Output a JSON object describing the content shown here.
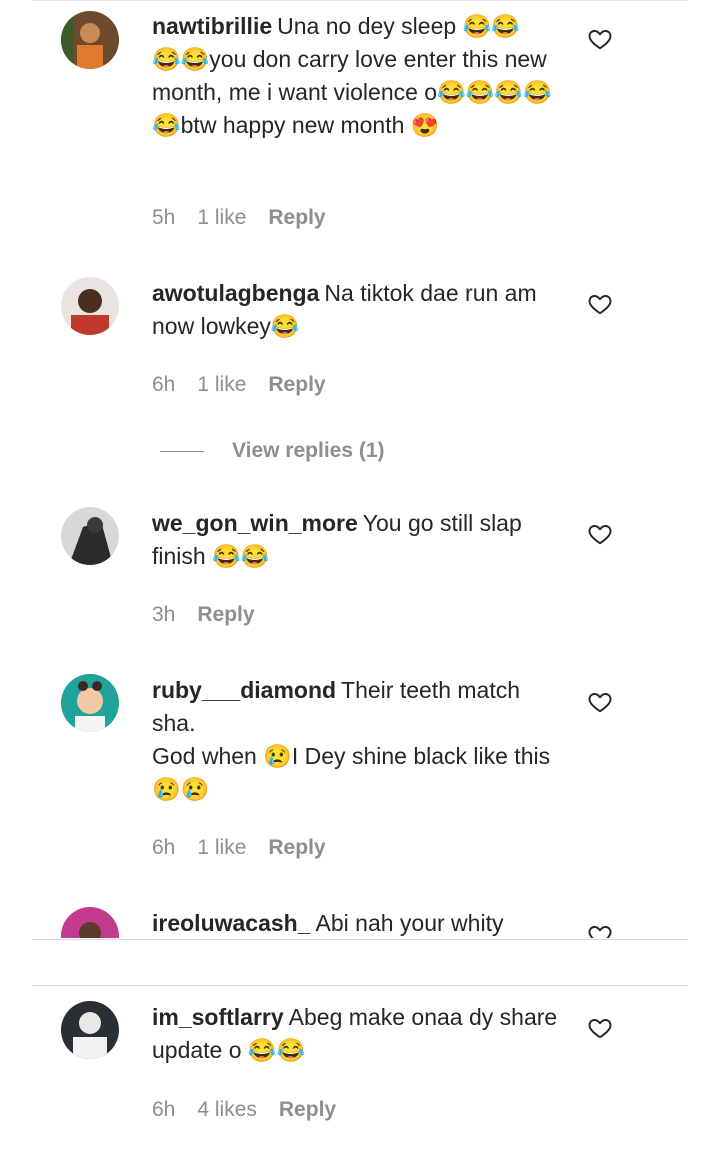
{
  "comments": [
    {
      "username": "nawtibrillie",
      "text": "Una no dey sleep 😂😂\n😂😂you don carry love enter this new month, me i want violence o😂😂😂😂😂btw happy new month 😍",
      "time": "5h",
      "likes": "1 like",
      "reply": "Reply"
    },
    {
      "username": "awotulagbenga",
      "text": "Na tiktok dae run am now lowkey😂",
      "time": "6h",
      "likes": "1 like",
      "reply": "Reply"
    },
    {
      "username": "we_gon_win_more",
      "text": "You go still slap finish 😂😂",
      "time": "3h",
      "reply": "Reply"
    },
    {
      "username": "ruby___diamond",
      "text": "Their teeth match sha.\nGod when 😢I Dey shine black like this 😢😢",
      "time": "6h",
      "likes": "1 like",
      "reply": "Reply"
    },
    {
      "username": "ireoluwacash_",
      "text": "Abi nah your whity"
    },
    {
      "username": "im_softlarry",
      "text": "Abeg make onaa dy share update o 😂😂",
      "time": "6h",
      "likes": "4 likes",
      "reply": "Reply"
    }
  ],
  "view_replies": "View replies (1)",
  "icons": {
    "like": "heart-outline-icon"
  },
  "colors": {
    "meta": "#8e8e8e",
    "text": "#262626"
  }
}
